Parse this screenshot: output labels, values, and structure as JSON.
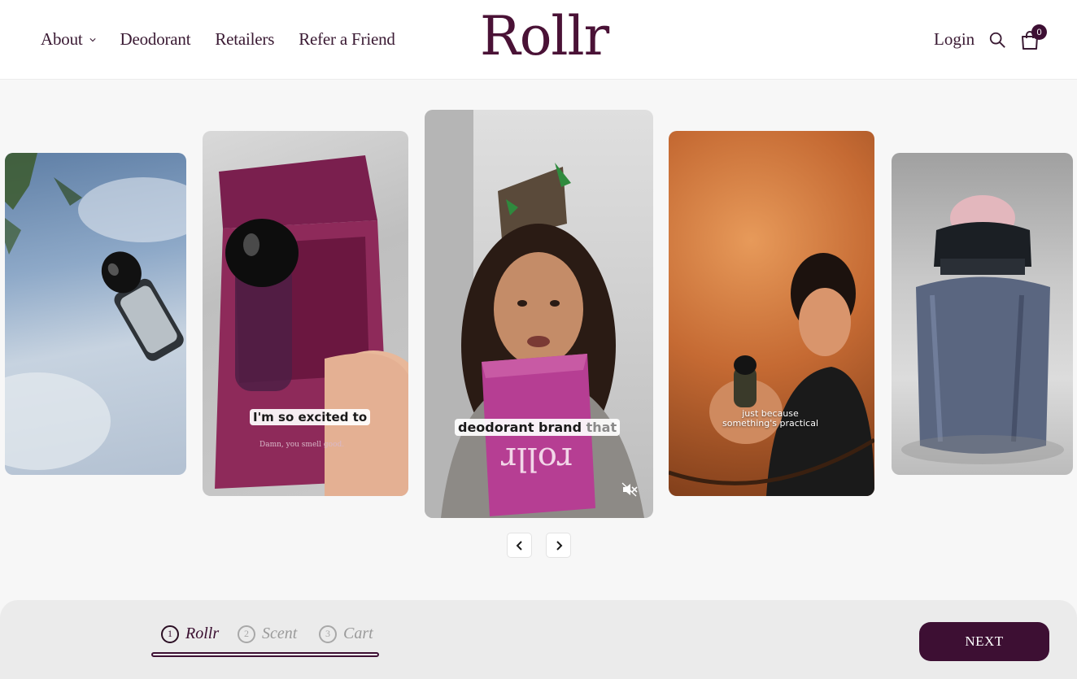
{
  "header": {
    "nav": [
      {
        "label": "About"
      },
      {
        "label": "Deodorant"
      },
      {
        "label": "Retailers"
      },
      {
        "label": "Refer a Friend"
      }
    ],
    "logo": "Rollr",
    "login": "Login",
    "cart_count": "0",
    "icons": {
      "search": "search-icon",
      "cart": "cart-icon",
      "about_dropdown": "chevron-down-icon"
    }
  },
  "carousel": {
    "slides": [
      {
        "caption": ""
      },
      {
        "caption": "I'm so excited to",
        "box_text": "Damn, you smell good."
      },
      {
        "caption_bold": "deodorant brand",
        "caption_light": "that",
        "box_text": "rollr"
      },
      {
        "caption": "just because something's practical"
      },
      {
        "caption": ""
      }
    ],
    "icons": {
      "prev": "chevron-left-icon",
      "next": "chevron-right-icon",
      "mute": "mute-icon"
    }
  },
  "steps": [
    {
      "number": "1",
      "label": "Rollr"
    },
    {
      "number": "2",
      "label": "Scent"
    },
    {
      "number": "3",
      "label": "Cart"
    }
  ],
  "next_button": "NEXT",
  "colors": {
    "brand": "#3d0f33",
    "background": "#f7f7f7",
    "bar": "#ebebeb"
  }
}
